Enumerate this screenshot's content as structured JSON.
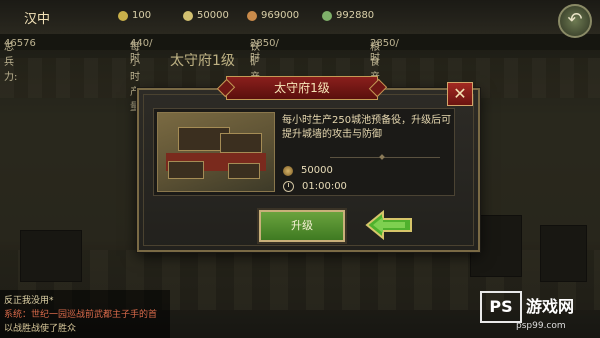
{
  "top_bar": {
    "city_name": "汉中",
    "resources": [
      {
        "icon": "food-icon",
        "value": "100",
        "color": "#c9b04a"
      },
      {
        "icon": "gold-icon",
        "value": "50000",
        "color": "#d2c070"
      },
      {
        "icon": "copper-icon",
        "value": "969000",
        "color": "#c98a4a"
      },
      {
        "icon": "jade-icon",
        "value": "992880",
        "color": "#7fb06a"
      }
    ],
    "stats": [
      {
        "label": "总兵力:",
        "value": "46576"
      },
      {
        "label": "每小时产量",
        "value": "440/时"
      },
      {
        "label": "铁矿产量",
        "value": "2850/时"
      },
      {
        "label": "粮食产量",
        "value": "2850/时"
      }
    ],
    "back_icon": "back-arrow-icon"
  },
  "background": {
    "building_label": "太守府1级"
  },
  "dialog": {
    "title": "太守府1级",
    "close_icon": "close-icon",
    "description": "每小时生产250城池预备役，升级后可提升城墙的攻击与防御",
    "cost": {
      "icon": "coin-icon",
      "value": "50000"
    },
    "time": {
      "icon": "clock-icon",
      "value": "01:00:00"
    },
    "upgrade_label": "升级",
    "pointer_icon": "green-arrow-icon"
  },
  "chat": {
    "lines": [
      "反正我没用*",
      "系统：世纪一园巡战前武都主子手的首",
      "以战胜战使了胜众"
    ]
  },
  "watermark": {
    "logo": "PS",
    "name": "游戏网",
    "url": "psp99.com"
  }
}
